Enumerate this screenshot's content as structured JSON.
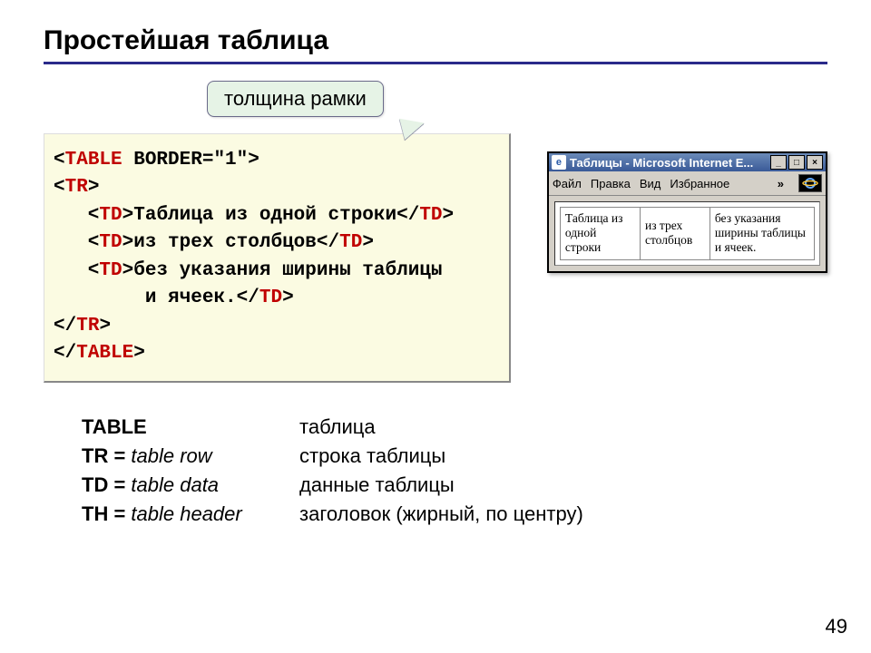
{
  "title": "Простейшая таблица",
  "callout": "толщина рамки",
  "code": {
    "l1_open": "<",
    "l1_tag": "TABLE",
    "l1_attr": " BORDER=\"1\"",
    "l1_close": ">",
    "l2_open": "<",
    "l2_tag": "TR",
    "l2_close": ">",
    "l3_pre": "   <",
    "l3_tag": "TD",
    "l3_mid": ">",
    "l3_txt": "Таблица из одной строки",
    "l3_ctag": "</",
    "l3_ctagn": "TD",
    "l3_end": ">",
    "l4_pre": "   <",
    "l4_tag": "TD",
    "l4_mid": ">",
    "l4_txt": "из трех столбцов",
    "l4_ctag": "</",
    "l4_ctagn": "TD",
    "l4_end": ">",
    "l5_pre": "   <",
    "l5_tag": "TD",
    "l5_mid": ">",
    "l5_txt": "без указания ширины таблицы",
    "l6_pre": "        ",
    "l6_txt": "и ячеек.",
    "l6_ctag": "</",
    "l6_ctagn": "TD",
    "l6_end": ">",
    "l7_open": "</",
    "l7_tag": "TR",
    "l7_close": ">",
    "l8_open": "</",
    "l8_tag": "TABLE",
    "l8_close": ">"
  },
  "browser": {
    "title": "Таблицы - Microsoft Internet E...",
    "ie_glyph": "e",
    "menu": {
      "file": "Файл",
      "edit": "Правка",
      "view": "Вид",
      "fav": "Избранное",
      "chev": "»"
    },
    "cells": {
      "c1": "Таблица из одной строки",
      "c2": "из трех столбцов",
      "c3": "без указания ширины таблицы и ячеек."
    },
    "btn_min": "_",
    "btn_max": "□",
    "btn_close": "×"
  },
  "defs": {
    "r1a": "TABLE",
    "r1b": "таблица",
    "r2a_b": "TR =",
    "r2a_i": " table row",
    "r2b": "строка таблицы",
    "r3a_b": "TD =",
    "r3a_i": " table data",
    "r3b": "данные таблицы",
    "r4a_b": "TH =",
    "r4a_i": " table header",
    "r4b": "заголовок (жирный, по центру)"
  },
  "pagenum": "49"
}
